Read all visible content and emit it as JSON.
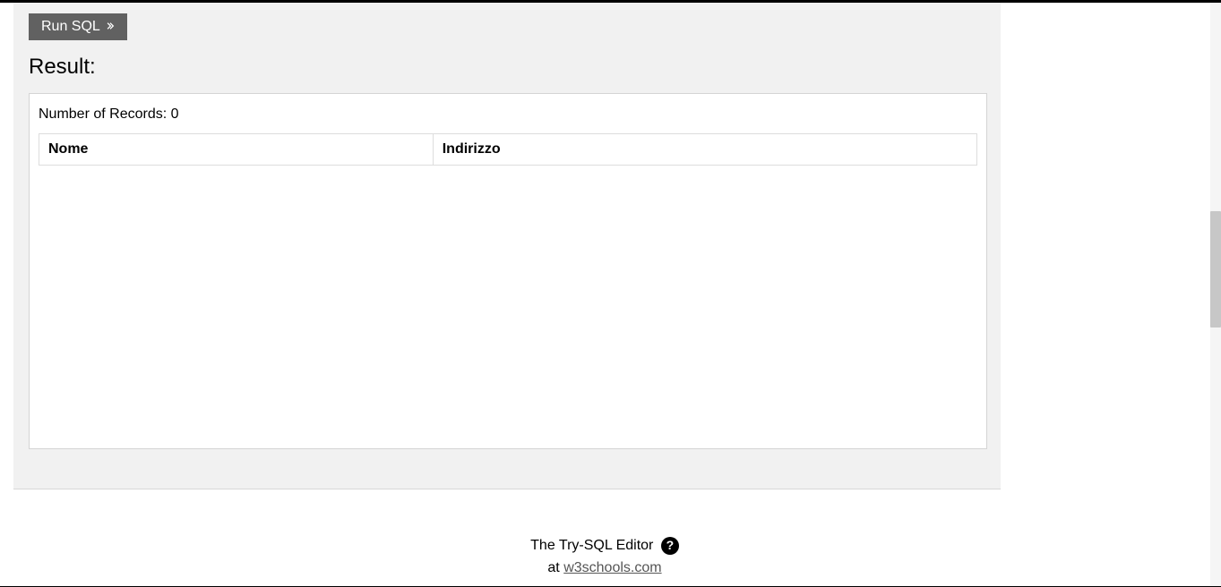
{
  "toolbar": {
    "run_label": "Run SQL"
  },
  "result": {
    "heading": "Result:",
    "records_label": "Number of Records: ",
    "records_count": "0",
    "columns": [
      "Nome",
      "Indirizzo"
    ]
  },
  "footer": {
    "editor_label": "The Try-SQL Editor",
    "help_glyph": "?",
    "at_label": "at ",
    "link_text": "w3schools.com"
  }
}
